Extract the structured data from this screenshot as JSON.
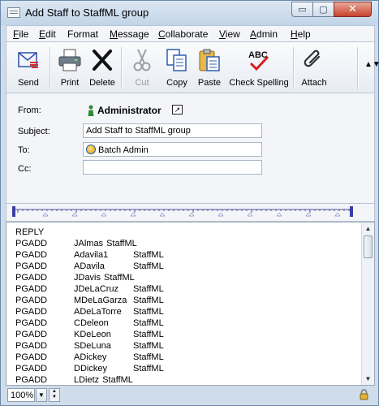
{
  "window": {
    "title": "Add Staff to StaffML group",
    "min_glyph": "▭",
    "max_glyph": "▢",
    "close_glyph": "✕"
  },
  "menu": [
    {
      "label": "File",
      "key": "F",
      "rest": "ile"
    },
    {
      "label": "Edit",
      "key": "E",
      "rest": "dit"
    },
    {
      "label": "Format",
      "key": "",
      "rest": "Format"
    },
    {
      "label": "Message",
      "key": "M",
      "rest": "essage"
    },
    {
      "label": "Collaborate",
      "key": "C",
      "rest": "ollaborate"
    },
    {
      "label": "View",
      "key": "V",
      "rest": "iew"
    },
    {
      "label": "Admin",
      "key": "A",
      "rest": "dmin"
    },
    {
      "label": "Help",
      "key": "H",
      "rest": "elp"
    }
  ],
  "toolbar": {
    "send": "Send",
    "print": "Print",
    "delete": "Delete",
    "cut": "Cut",
    "copy": "Copy",
    "paste": "Paste",
    "check_spelling": "Check Spelling",
    "spelling_icon_text": "ABC",
    "attach": "Attach",
    "overflow_glyph": "▲▼"
  },
  "headers": {
    "from_label": "From:",
    "from_value": "Administrator",
    "subject_label": "Subject:",
    "subject_value": "Add Staff to StaffML group",
    "to_label": "To:",
    "to_value": "Batch Admin",
    "cc_label": "Cc:",
    "cc_value": ""
  },
  "body": {
    "first_line": "REPLY",
    "rows": [
      {
        "cmd": "PGADD",
        "user": "JAlmas",
        "group": "StaffML",
        "inline": true
      },
      {
        "cmd": "PGADD",
        "user": "Adavila1",
        "group": "StaffML",
        "inline": false
      },
      {
        "cmd": "PGADD",
        "user": "ADavila",
        "group": "StaffML",
        "inline": false
      },
      {
        "cmd": "PGADD",
        "user": "JDavis",
        "group": "StaffML",
        "inline": true
      },
      {
        "cmd": "PGADD",
        "user": "JDeLaCruz",
        "group": "StaffML",
        "inline": false
      },
      {
        "cmd": "PGADD",
        "user": "MDeLaGarza",
        "group": "StaffML",
        "inline": false
      },
      {
        "cmd": "PGADD",
        "user": "ADeLaTorre",
        "group": "StaffML",
        "inline": false
      },
      {
        "cmd": "PGADD",
        "user": "CDeleon",
        "group": "StaffML",
        "inline": false
      },
      {
        "cmd": "PGADD",
        "user": "KDeLeon",
        "group": "StaffML",
        "inline": false
      },
      {
        "cmd": "PGADD",
        "user": "SDeLuna",
        "group": "StaffML",
        "inline": false
      },
      {
        "cmd": "PGADD",
        "user": "ADickey",
        "group": "StaffML",
        "inline": false
      },
      {
        "cmd": "PGADD",
        "user": "DDickey",
        "group": "StaffML",
        "inline": false
      },
      {
        "cmd": "PGADD",
        "user": "LDietz",
        "group": "StaffML",
        "inline": true
      }
    ]
  },
  "status": {
    "zoom": "100%"
  }
}
